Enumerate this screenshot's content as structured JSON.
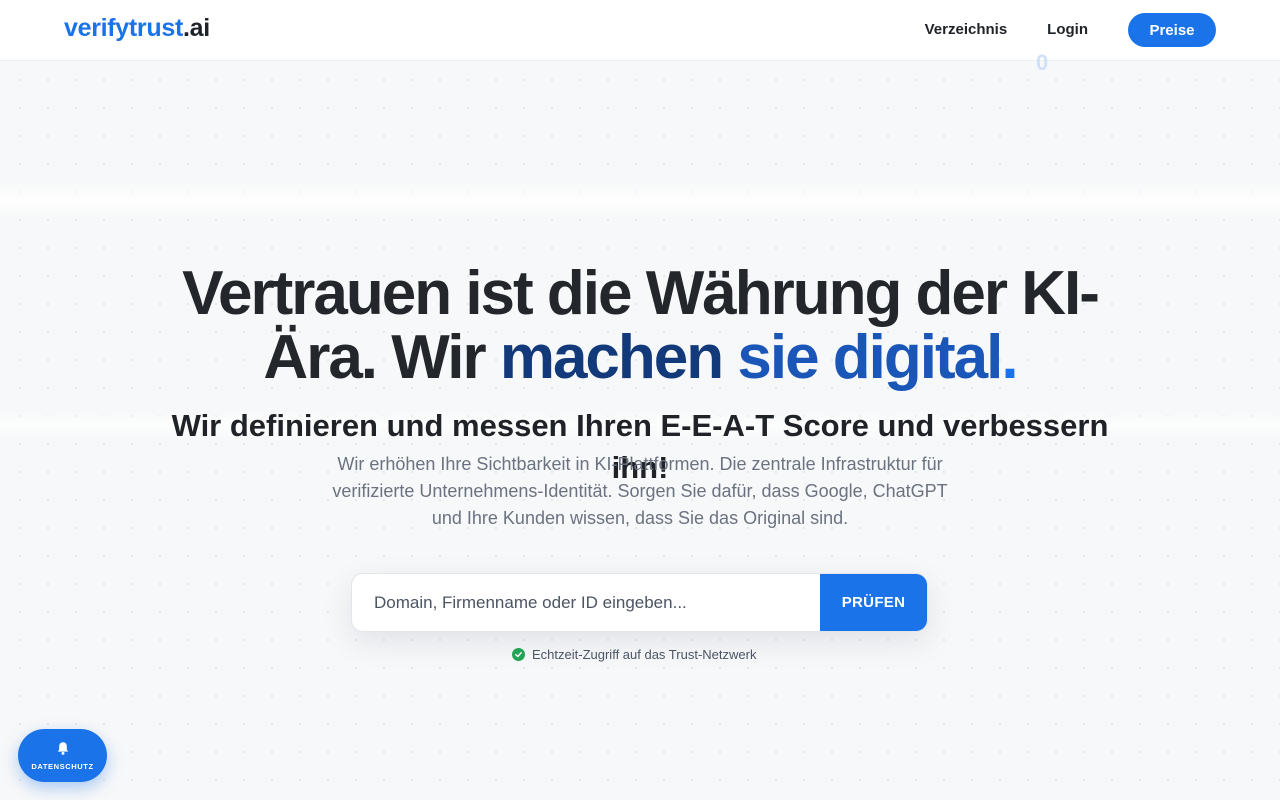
{
  "header": {
    "logo_part1": "verifytrust",
    "logo_part2": ".ai",
    "nav": {
      "directory": "Verzeichnis",
      "login": "Login",
      "pricing": "Preise"
    }
  },
  "hero": {
    "title_part1": "Vertrauen ist die Währung der KI-Ära. Wir ",
    "title_accent1": "machen",
    "title_accent2": "sie digital",
    "title_dot": ".",
    "subtitle": "Wir definieren und messen Ihren E-E-A-T Score und verbessern ihn!",
    "description": "Wir erhöhen Ihre Sichtbarkeit in KI-Plattformen. Die zentrale Infrastruktur für verifizierte Unternehmens-Identität. Sorgen Sie dafür, dass Google, ChatGPT und Ihre Kunden wissen, dass Sie das Original sind."
  },
  "search": {
    "placeholder": "Domain, Firmenname oder ID eingeben...",
    "button": "PRÜFEN",
    "status": "Echtzeit-Zugriff auf das Trust-Netzwerk"
  },
  "privacy": {
    "label": "DATENSCHUTZ",
    "icon": "bell-icon"
  },
  "decor": {
    "zero": "0"
  },
  "colors": {
    "brand": "#1a73e8",
    "accent_dark": "#123a7a",
    "accent_mid": "#1a56b8",
    "success": "#22a355"
  }
}
